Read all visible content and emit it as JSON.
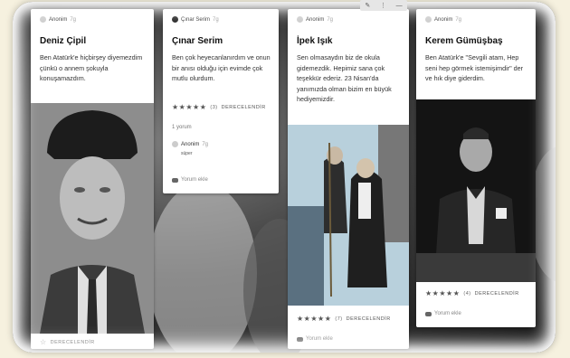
{
  "cards": [
    {
      "author": "Anonim",
      "author_sub": "7g",
      "title": "Deniz Çipil",
      "body": "Ben Atatürk'e hiçbirşey diyemezdim çünkü o annem şokuyla konuşamazdım.",
      "rate_label": "DERECELENDİR"
    },
    {
      "author": "Çınar Serim",
      "author_sub": "7g",
      "title": "Çınar Serim",
      "body": "Ben çok heyecanlanırdım ve onun bir anısı olduğu için evimde çok mutlu olurdum.",
      "stars": "★★★★★",
      "star_count": "(3)",
      "rate_label": "DERECELENDİR",
      "reply_count": "1 yorum",
      "reply_author": "Anonim",
      "reply_sub": "7g",
      "reply_text": "süper",
      "comment_label": "Yorum ekle"
    },
    {
      "author": "Anonim",
      "author_sub": "7g",
      "title": "İpek Işık",
      "body": "Sen olmasaydın biz de okula gidemezdik. Hepimiz sana çok teşekkür ederiz. 23 Nisan'da yanımızda olman bizim en büyük hediyemizdir.",
      "stars": "★★★★★",
      "star_count": "(7)",
      "rate_label": "DERECELENDİR",
      "comment_label": "Yorum ekle"
    },
    {
      "author": "Anonim",
      "author_sub": "7g",
      "title": "Kerem Gümüşbaş",
      "body": "Ben Atatürk'e \"Sevgili atam, Hep seni hep görmek istemişimdir\" der ve hık diye giderdim.",
      "stars": "★★★★★",
      "star_count": "(4)",
      "rate_label": "DERECELENDİR",
      "comment_label": "Yorum ekle"
    }
  ],
  "toolbar": {
    "icons": [
      "pencil-icon",
      "more-icon"
    ]
  }
}
